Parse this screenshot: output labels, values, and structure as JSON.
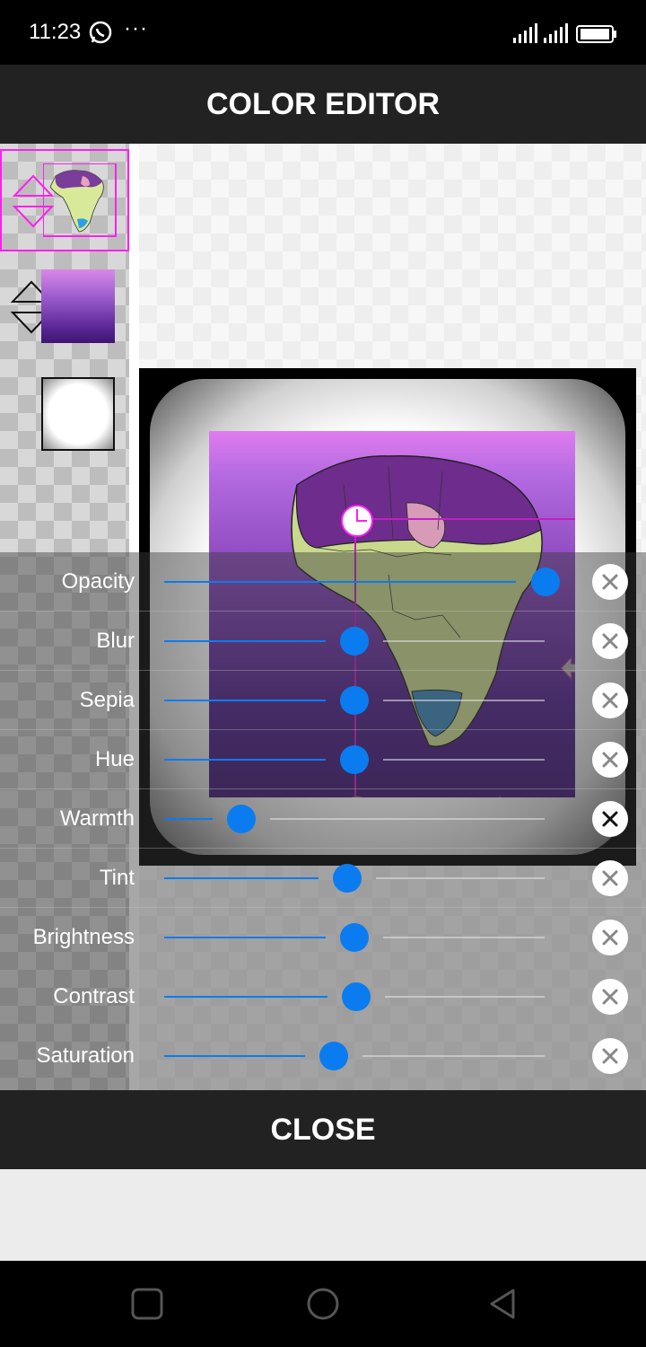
{
  "status_bar": {
    "time": "11:23",
    "more": "···",
    "icons": [
      "whatsapp-icon",
      "signal-icon",
      "signal-icon",
      "battery-icon"
    ]
  },
  "header": {
    "title": "COLOR EDITOR"
  },
  "layers": [
    {
      "name": "africa-map-layer",
      "selected": true
    },
    {
      "name": "purple-texture-layer",
      "selected": false
    },
    {
      "name": "white-vignette-layer",
      "selected": false
    }
  ],
  "adjustments": [
    {
      "label": "Opacity",
      "value": 0.95
    },
    {
      "label": "Blur",
      "value": 0.5
    },
    {
      "label": "Sepia",
      "value": 0.5
    },
    {
      "label": "Hue",
      "value": 0.5
    },
    {
      "label": "Warmth",
      "value": 0.2
    },
    {
      "label": "Tint",
      "value": 0.48
    },
    {
      "label": "Brightness",
      "value": 0.5
    },
    {
      "label": "Contrast",
      "value": 0.51
    },
    {
      "label": "Saturation",
      "value": 0.45
    }
  ],
  "footer": {
    "close_label": "CLOSE"
  },
  "colors": {
    "accent": "#0a7cf0",
    "selection": "#ff1ff0",
    "header_bg": "#222222"
  }
}
